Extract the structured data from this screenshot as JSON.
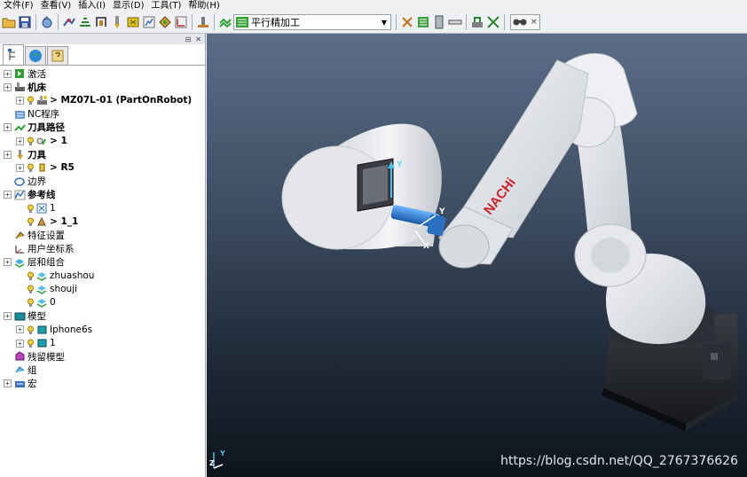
{
  "menu": [
    "文件(F)",
    "查看(V)",
    "插入(I)",
    "显示(D)",
    "工具(T)",
    "帮助(H)"
  ],
  "toolbar": {
    "strategy_combo_value": "平行精加工",
    "icons": [
      "folder-open-icon",
      "save-icon",
      "undo-icon",
      "toolpath-icon",
      "roughing-icon",
      "finishing-icon",
      "tool-icon",
      "boundary-icon",
      "pattern-icon",
      "feature-icon",
      "simulate-icon",
      "strategy-icon"
    ]
  },
  "explorer": {
    "header_buttons": [
      "pin-icon",
      "close-icon"
    ],
    "tabs": [
      "tree-tab-icon",
      "globe-tab-icon",
      "help-tab-icon"
    ]
  },
  "tree": [
    {
      "label": "激活",
      "bold": false,
      "icon": "activate-icon",
      "level": 0,
      "expandable": true
    },
    {
      "label": "机床",
      "bold": true,
      "icon": "machine-icon",
      "level": 0,
      "expandable": true
    },
    {
      "label": "> MZ07L-01 (PartOnRobot)",
      "bold": true,
      "icon": "machine-item-icon",
      "level": 1,
      "expandable": true
    },
    {
      "label": "NC程序",
      "bold": false,
      "icon": "nc-program-icon",
      "level": 0,
      "expandable": false
    },
    {
      "label": "刀具路径",
      "bold": true,
      "icon": "toolpath-folder-icon",
      "level": 0,
      "expandable": true
    },
    {
      "label": "> 1",
      "bold": true,
      "icon": "toolpath-item-icon",
      "level": 1,
      "expandable": true
    },
    {
      "label": "刀具",
      "bold": true,
      "icon": "tool-folder-icon",
      "level": 0,
      "expandable": true
    },
    {
      "label": "> R5",
      "bold": true,
      "icon": "tool-item-icon",
      "level": 1,
      "expandable": true
    },
    {
      "label": "边界",
      "bold": false,
      "icon": "boundary-folder-icon",
      "level": 0,
      "expandable": false
    },
    {
      "label": "参考线",
      "bold": true,
      "icon": "pattern-folder-icon",
      "level": 0,
      "expandable": true
    },
    {
      "label": "1",
      "bold": false,
      "icon": "pattern-item-icon",
      "level": 1,
      "expandable": false
    },
    {
      "label": "> 1_1",
      "bold": true,
      "icon": "pattern-item-active-icon",
      "level": 1,
      "expandable": false
    },
    {
      "label": "特征设置",
      "bold": false,
      "icon": "feature-set-icon",
      "level": 0,
      "expandable": false
    },
    {
      "label": "用户坐标系",
      "bold": false,
      "icon": "workplane-icon",
      "level": 0,
      "expandable": false
    },
    {
      "label": "层和组合",
      "bold": false,
      "icon": "layers-icon",
      "level": 0,
      "expandable": true
    },
    {
      "label": "zhuashou",
      "bold": false,
      "icon": "layer-item-icon",
      "level": 1,
      "expandable": false
    },
    {
      "label": "shouji",
      "bold": false,
      "icon": "layer-item-icon",
      "level": 1,
      "expandable": false
    },
    {
      "label": "0",
      "bold": false,
      "icon": "layer-item-icon",
      "level": 1,
      "expandable": false
    },
    {
      "label": "模型",
      "bold": false,
      "icon": "model-folder-icon",
      "level": 0,
      "expandable": true
    },
    {
      "label": "Iphone6s",
      "bold": false,
      "icon": "model-item-icon",
      "level": 1,
      "expandable": true
    },
    {
      "label": "1",
      "bold": false,
      "icon": "model-item-icon",
      "level": 1,
      "expandable": true
    },
    {
      "label": "残留模型",
      "bold": false,
      "icon": "stock-model-icon",
      "level": 0,
      "expandable": false
    },
    {
      "label": "组",
      "bold": false,
      "icon": "group-icon",
      "level": 0,
      "expandable": false
    },
    {
      "label": "宏",
      "bold": false,
      "icon": "macro-icon",
      "level": 0,
      "expandable": true
    }
  ],
  "viewport": {
    "robot_brand": "NACHi",
    "axis_y": "Y",
    "axis_x": "X",
    "axis_z": "Z",
    "watermark": "https://blog.csdn.net/QQ_2767376626"
  },
  "colors": {
    "tree_green": "#2ea02e",
    "robot_white": "#eceef2",
    "brand_red": "#d0202a",
    "viewport_top": "#5a6e86",
    "viewport_bottom": "#0e141c"
  }
}
